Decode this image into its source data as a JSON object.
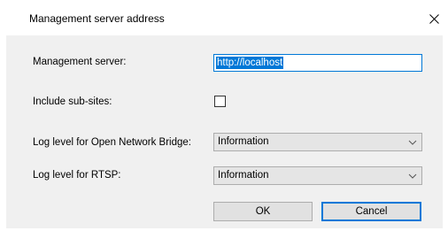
{
  "window": {
    "title": "Management server address",
    "close_glyph": "✕"
  },
  "form": {
    "server_label": "Management server:",
    "server_value": "http://localhost",
    "subsites_label": "Include sub-sites:",
    "subsites_checked": false,
    "onb_log_label": "Log level for Open Network Bridge:",
    "onb_log_value": "Information",
    "rtsp_log_label": "Log level for RTSP:",
    "rtsp_log_value": "Information"
  },
  "buttons": {
    "ok_label": "OK",
    "cancel_label": "Cancel"
  },
  "icons": {
    "close": "close-icon",
    "dropdown": "chevron-down-icon"
  },
  "colors": {
    "accent": "#0078d7",
    "body_bg": "#f0f0f0",
    "select_bg": "#e5e5e5",
    "button_bg": "#e1e1e1"
  }
}
